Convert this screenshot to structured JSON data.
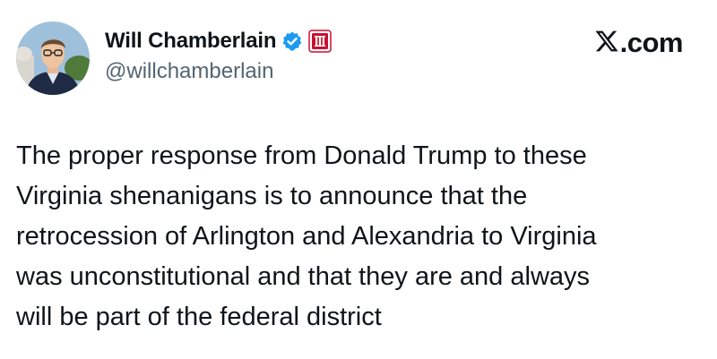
{
  "author": {
    "display_name": "Will Chamberlain",
    "handle": "@willchamberlain",
    "verified": true,
    "verified_color": "#1d9bf0",
    "affiliate_badge_color": "#c8102e"
  },
  "brand": {
    "label": ".com",
    "icon": "x-logo-icon"
  },
  "tweet": {
    "text": "The proper response from Donald Trump to these\nVirginia shenanigans is to announce that the\nretrocession of Arlington and Alexandria to Virginia\nwas unconstitutional and that they are and always\nwill be part of the federal district"
  }
}
